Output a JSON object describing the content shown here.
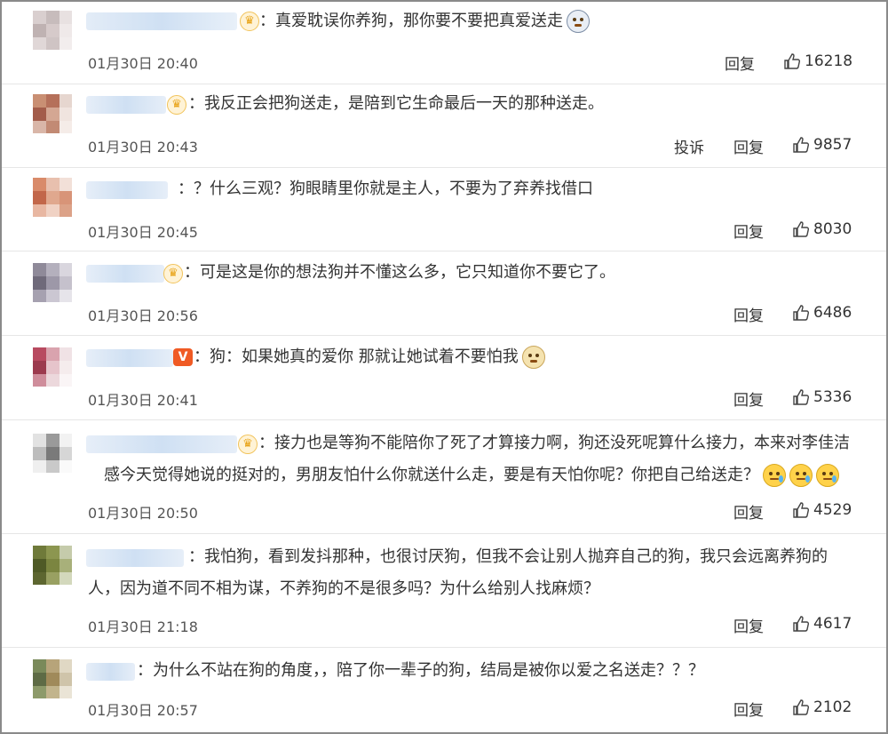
{
  "comments": [
    {
      "text": "真爱耽误你养狗，那你要不要把真爱送走",
      "time": "01月30日 20:40",
      "report": "",
      "reply": "回复",
      "likes": "16218",
      "badge": "crown",
      "emoji": [
        "husky"
      ]
    },
    {
      "text": "我反正会把狗送走，是陪到它生命最后一天的那种送走。",
      "time": "01月30日 20:43",
      "report": "投诉",
      "reply": "回复",
      "likes": "9857",
      "badge": "crown",
      "emoji": []
    },
    {
      "text": "？什么三观？狗眼睛里你就是主人，不要为了弃养找借口",
      "time": "01月30日 20:45",
      "report": "",
      "reply": "回复",
      "likes": "8030",
      "badge": "none",
      "emoji": []
    },
    {
      "text": "可是这是你的想法狗并不懂这么多，它只知道你不要它了。",
      "time": "01月30日 20:56",
      "report": "",
      "reply": "回复",
      "likes": "6486",
      "badge": "crown",
      "emoji": []
    },
    {
      "text": "狗：如果她真的爱你 那就让她试着不要怕我",
      "time": "01月30日 20:41",
      "report": "",
      "reply": "回复",
      "likes": "5336",
      "badge": "v",
      "emoji": [
        "dog"
      ]
    },
    {
      "text_line1": "接力也是等狗不能陪你了死了才算接力啊，狗还没死呢算什么接力，本来对李佳洁",
      "text_line2": "感今天觉得她说的挺对的，男朋友怕什么你就送什么走，要是有天怕你呢？你把自己给送走？",
      "time": "01月30日 20:50",
      "report": "",
      "reply": "回复",
      "likes": "4529",
      "badge": "crown",
      "emoji": [
        "cry",
        "cry",
        "cry"
      ]
    },
    {
      "text_line1": "我怕狗，看到发抖那种，也很讨厌狗，但我不会让别人抛弃自己的狗，我只会远离养狗的",
      "text_line2": "人，因为道不同不相为谋，不养狗的不是很多吗？为什么给别人找麻烦？",
      "time": "01月30日 21:18",
      "report": "",
      "reply": "回复",
      "likes": "4617",
      "badge": "none",
      "emoji": []
    },
    {
      "text": "为什么不站在狗的角度，，陪了你一辈子的狗，结局是被你以爱之名送走？？？",
      "time": "01月30日 20:57",
      "report": "",
      "reply": "回复",
      "likes": "2102",
      "badge": "none",
      "emoji": []
    }
  ],
  "colors": {
    "text": "#333333",
    "time": "#555555",
    "divider": "#e6e6e6",
    "frame": "#8a8a8a"
  },
  "icons": {
    "like": "thumbs-up-icon",
    "crown": "crown-badge-icon",
    "verified": "verified-v-badge-icon"
  }
}
